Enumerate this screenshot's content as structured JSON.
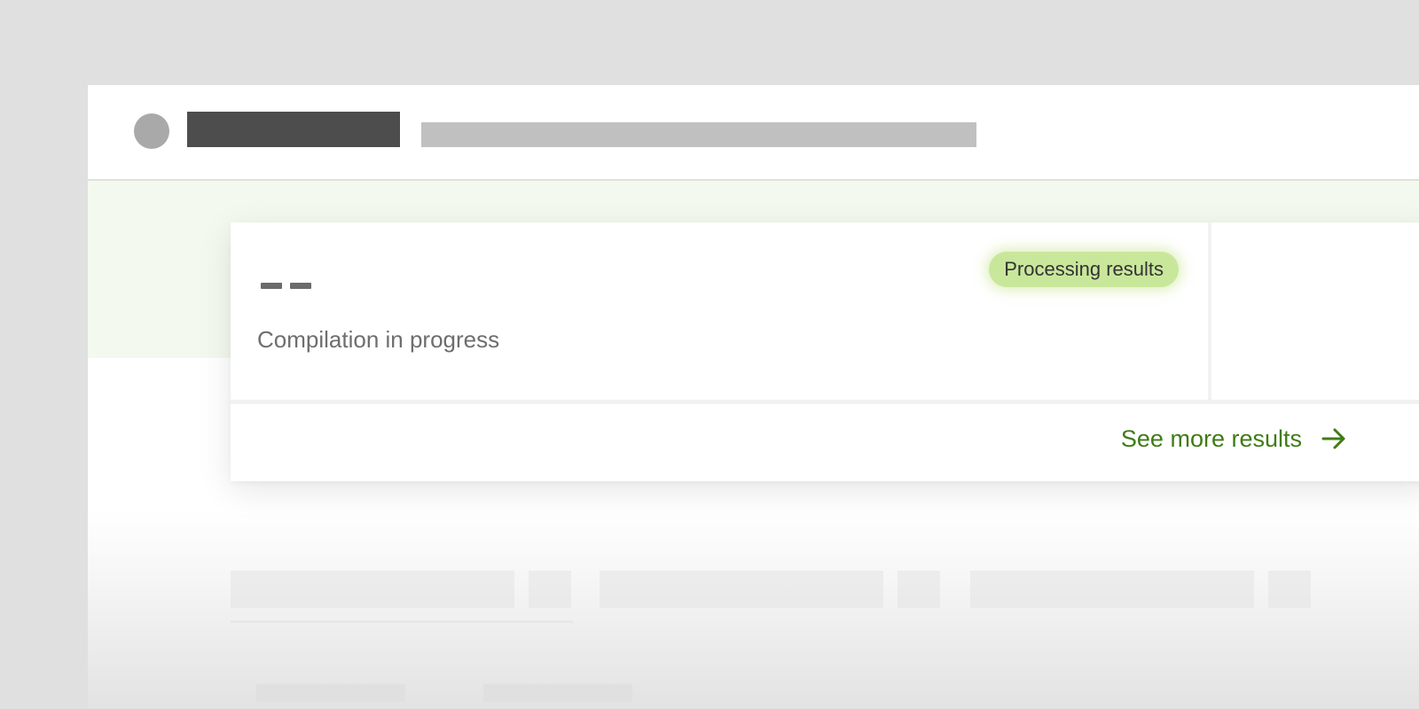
{
  "summary_card": {
    "score_placeholder": "--",
    "status_text": "Compilation in progress",
    "badge_label": "Processing results"
  },
  "footer_link": {
    "label": "See more results",
    "icon": "arrow-right-icon"
  },
  "colors": {
    "page_background": "#e0e0e0",
    "green_band": "#f3f9ef",
    "badge_background": "#c9e79b",
    "link_text": "#3f7c14"
  }
}
